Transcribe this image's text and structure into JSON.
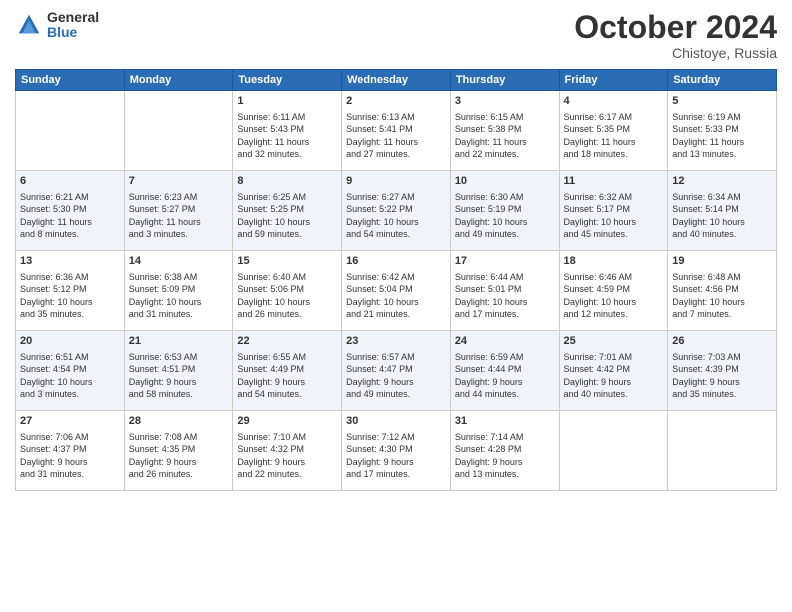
{
  "logo": {
    "general": "General",
    "blue": "Blue"
  },
  "title": "October 2024",
  "location": "Chistoye, Russia",
  "days_header": [
    "Sunday",
    "Monday",
    "Tuesday",
    "Wednesday",
    "Thursday",
    "Friday",
    "Saturday"
  ],
  "weeks": [
    [
      {
        "day": "",
        "info": ""
      },
      {
        "day": "",
        "info": ""
      },
      {
        "day": "1",
        "info": "Sunrise: 6:11 AM\nSunset: 5:43 PM\nDaylight: 11 hours\nand 32 minutes."
      },
      {
        "day": "2",
        "info": "Sunrise: 6:13 AM\nSunset: 5:41 PM\nDaylight: 11 hours\nand 27 minutes."
      },
      {
        "day": "3",
        "info": "Sunrise: 6:15 AM\nSunset: 5:38 PM\nDaylight: 11 hours\nand 22 minutes."
      },
      {
        "day": "4",
        "info": "Sunrise: 6:17 AM\nSunset: 5:35 PM\nDaylight: 11 hours\nand 18 minutes."
      },
      {
        "day": "5",
        "info": "Sunrise: 6:19 AM\nSunset: 5:33 PM\nDaylight: 11 hours\nand 13 minutes."
      }
    ],
    [
      {
        "day": "6",
        "info": "Sunrise: 6:21 AM\nSunset: 5:30 PM\nDaylight: 11 hours\nand 8 minutes."
      },
      {
        "day": "7",
        "info": "Sunrise: 6:23 AM\nSunset: 5:27 PM\nDaylight: 11 hours\nand 3 minutes."
      },
      {
        "day": "8",
        "info": "Sunrise: 6:25 AM\nSunset: 5:25 PM\nDaylight: 10 hours\nand 59 minutes."
      },
      {
        "day": "9",
        "info": "Sunrise: 6:27 AM\nSunset: 5:22 PM\nDaylight: 10 hours\nand 54 minutes."
      },
      {
        "day": "10",
        "info": "Sunrise: 6:30 AM\nSunset: 5:19 PM\nDaylight: 10 hours\nand 49 minutes."
      },
      {
        "day": "11",
        "info": "Sunrise: 6:32 AM\nSunset: 5:17 PM\nDaylight: 10 hours\nand 45 minutes."
      },
      {
        "day": "12",
        "info": "Sunrise: 6:34 AM\nSunset: 5:14 PM\nDaylight: 10 hours\nand 40 minutes."
      }
    ],
    [
      {
        "day": "13",
        "info": "Sunrise: 6:36 AM\nSunset: 5:12 PM\nDaylight: 10 hours\nand 35 minutes."
      },
      {
        "day": "14",
        "info": "Sunrise: 6:38 AM\nSunset: 5:09 PM\nDaylight: 10 hours\nand 31 minutes."
      },
      {
        "day": "15",
        "info": "Sunrise: 6:40 AM\nSunset: 5:06 PM\nDaylight: 10 hours\nand 26 minutes."
      },
      {
        "day": "16",
        "info": "Sunrise: 6:42 AM\nSunset: 5:04 PM\nDaylight: 10 hours\nand 21 minutes."
      },
      {
        "day": "17",
        "info": "Sunrise: 6:44 AM\nSunset: 5:01 PM\nDaylight: 10 hours\nand 17 minutes."
      },
      {
        "day": "18",
        "info": "Sunrise: 6:46 AM\nSunset: 4:59 PM\nDaylight: 10 hours\nand 12 minutes."
      },
      {
        "day": "19",
        "info": "Sunrise: 6:48 AM\nSunset: 4:56 PM\nDaylight: 10 hours\nand 7 minutes."
      }
    ],
    [
      {
        "day": "20",
        "info": "Sunrise: 6:51 AM\nSunset: 4:54 PM\nDaylight: 10 hours\nand 3 minutes."
      },
      {
        "day": "21",
        "info": "Sunrise: 6:53 AM\nSunset: 4:51 PM\nDaylight: 9 hours\nand 58 minutes."
      },
      {
        "day": "22",
        "info": "Sunrise: 6:55 AM\nSunset: 4:49 PM\nDaylight: 9 hours\nand 54 minutes."
      },
      {
        "day": "23",
        "info": "Sunrise: 6:57 AM\nSunset: 4:47 PM\nDaylight: 9 hours\nand 49 minutes."
      },
      {
        "day": "24",
        "info": "Sunrise: 6:59 AM\nSunset: 4:44 PM\nDaylight: 9 hours\nand 44 minutes."
      },
      {
        "day": "25",
        "info": "Sunrise: 7:01 AM\nSunset: 4:42 PM\nDaylight: 9 hours\nand 40 minutes."
      },
      {
        "day": "26",
        "info": "Sunrise: 7:03 AM\nSunset: 4:39 PM\nDaylight: 9 hours\nand 35 minutes."
      }
    ],
    [
      {
        "day": "27",
        "info": "Sunrise: 7:06 AM\nSunset: 4:37 PM\nDaylight: 9 hours\nand 31 minutes."
      },
      {
        "day": "28",
        "info": "Sunrise: 7:08 AM\nSunset: 4:35 PM\nDaylight: 9 hours\nand 26 minutes."
      },
      {
        "day": "29",
        "info": "Sunrise: 7:10 AM\nSunset: 4:32 PM\nDaylight: 9 hours\nand 22 minutes."
      },
      {
        "day": "30",
        "info": "Sunrise: 7:12 AM\nSunset: 4:30 PM\nDaylight: 9 hours\nand 17 minutes."
      },
      {
        "day": "31",
        "info": "Sunrise: 7:14 AM\nSunset: 4:28 PM\nDaylight: 9 hours\nand 13 minutes."
      },
      {
        "day": "",
        "info": ""
      },
      {
        "day": "",
        "info": ""
      }
    ]
  ]
}
